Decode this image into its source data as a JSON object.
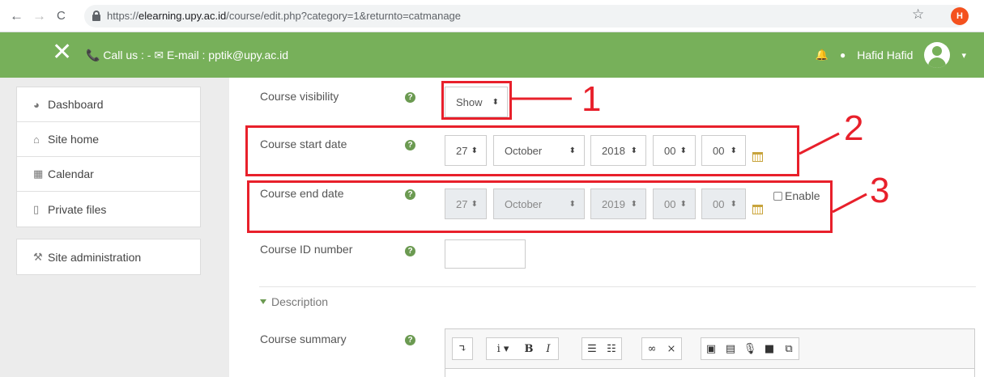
{
  "browser": {
    "back_glyph": "←",
    "forward_glyph": "→",
    "reload_glyph": "C",
    "url_prefix": "https://",
    "url_host": "elearning.upy.ac.id",
    "url_path": "/course/edit.php?category=1&returnto=catmanage",
    "bookmark_glyph": "☆",
    "extension_label": "H"
  },
  "navbar": {
    "close_glyph": "✕",
    "contact_text": "📞 Call us : -  ✉ E-mail : pptik@upy.ac.id",
    "bell_glyph": "🔔",
    "chat_glyph": "●",
    "user_name": "Hafid Hafid",
    "caret": "▾",
    "color": "#77b05a"
  },
  "sidebar": {
    "items": [
      {
        "icon": "dashboard-icon",
        "glyph": "◕",
        "label": "Dashboard"
      },
      {
        "icon": "home-icon",
        "glyph": "⌂",
        "label": "Site home"
      },
      {
        "icon": "calendar-icon",
        "glyph": "▦",
        "label": "Calendar"
      },
      {
        "icon": "file-icon",
        "glyph": "▯",
        "label": "Private files"
      }
    ],
    "admin": {
      "icon": "wrench-icon",
      "glyph": "⚒",
      "label": "Site administration"
    }
  },
  "form": {
    "help_glyph": "?",
    "visibility": {
      "label": "Course visibility",
      "value": "Show"
    },
    "start_date": {
      "label": "Course start date",
      "day": "27",
      "month": "October",
      "year": "2018",
      "hour": "00",
      "minute": "00"
    },
    "end_date": {
      "label": "Course end date",
      "day": "27",
      "month": "October",
      "year": "2019",
      "hour": "00",
      "minute": "00",
      "enable_label": "Enable",
      "enabled": false
    },
    "id_number": {
      "label": "Course ID number",
      "value": ""
    },
    "description_header": "Description",
    "summary": {
      "label": "Course summary"
    }
  },
  "editor_toolbar": {
    "groups": [
      [
        "↴"
      ],
      [
        "i ▾",
        "B",
        "I"
      ],
      [
        "☰",
        "☷"
      ],
      [
        "∞",
        "⨯"
      ],
      [
        "▣",
        "▤",
        "🎙",
        "■",
        "⧉"
      ]
    ]
  },
  "annotations": {
    "labels": [
      "1",
      "2",
      "3"
    ],
    "color": "#e8202b"
  },
  "select_arrow": "⬍"
}
